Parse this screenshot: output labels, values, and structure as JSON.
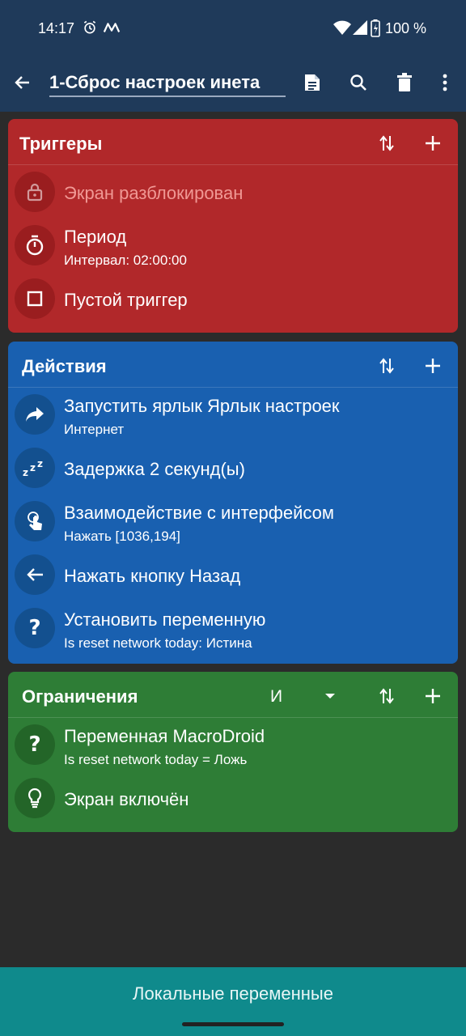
{
  "status_bar": {
    "time": "14:17",
    "battery": "100 %"
  },
  "app_bar": {
    "title": "1-Сброс настроек инета"
  },
  "triggers": {
    "title": "Триггеры",
    "items": [
      {
        "label": "Экран разблокирован",
        "sub": "",
        "icon": "lock-icon",
        "disabled": true
      },
      {
        "label": "Период",
        "sub": "Интервал: 02:00:00",
        "icon": "timer-icon"
      },
      {
        "label": "Пустой триггер",
        "sub": "",
        "icon": "square-icon"
      }
    ]
  },
  "actions": {
    "title": "Действия",
    "items": [
      {
        "label": "Запустить ярлык Ярлык настроек",
        "sub": "Интернет",
        "icon": "share-arrow-icon"
      },
      {
        "label": "Задержка 2 секунд(ы)",
        "sub": "",
        "icon": "sleep-zzz-icon"
      },
      {
        "label": "Взаимодействие с интерфейсом",
        "sub": "Нажать [1036,194]",
        "icon": "touch-icon"
      },
      {
        "label": "Нажать кнопку Назад",
        "sub": "",
        "icon": "back-arrow-icon"
      },
      {
        "label": "Установить переменную",
        "sub": "Is reset network today: Истина",
        "icon": "question-icon"
      }
    ]
  },
  "constraints": {
    "title": "Ограничения",
    "logic_operator": "И",
    "items": [
      {
        "label": "Переменная MacroDroid",
        "sub": "Is reset network today = Ложь",
        "icon": "question-icon"
      },
      {
        "label": "Экран включён",
        "sub": "",
        "icon": "lightbulb-icon"
      }
    ]
  },
  "bottom_bar": {
    "label": "Локальные переменные"
  },
  "colors": {
    "triggers": "#b1282a",
    "actions": "#1960b0",
    "constraints": "#2e7d36",
    "bottom_bar": "#0f8a8c",
    "app_bar": "#1f3a5a"
  }
}
